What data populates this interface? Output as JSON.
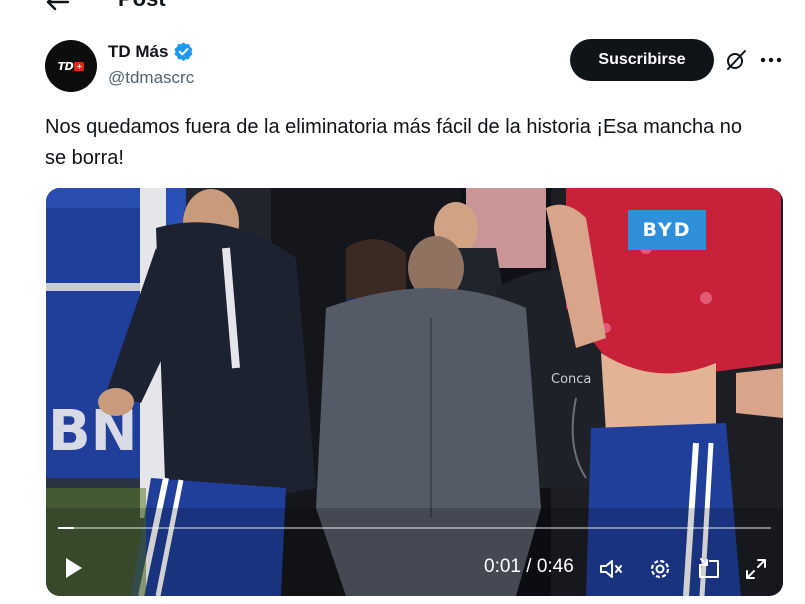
{
  "header": {
    "title": "Post",
    "back_icon": "arrow-left-icon"
  },
  "author": {
    "avatar_text": "TD",
    "avatar_plus": "+",
    "name": "TD Más",
    "handle": "@tdmascrc",
    "verified": true,
    "verified_color": "#1d9bf0"
  },
  "actions": {
    "subscribe_label": "Suscribirse",
    "grok_icon": "grok-icon",
    "more_icon": "more-icon"
  },
  "tweet": {
    "text": "Nos quedamos fuera de la eliminatoria más fácil de la historia ¡Esa mancha no se borra!"
  },
  "video": {
    "sponsor_badge": "BYD",
    "current_time": "0:01",
    "duration": "0:46",
    "time_text": "0:01 / 0:46",
    "progress_fraction": 0.022,
    "controls": [
      "play-icon",
      "mute-icon",
      "settings-icon",
      "pip-icon",
      "fullscreen-icon"
    ]
  },
  "colors": {
    "text_primary": "#0f1419",
    "text_secondary": "#536471",
    "button_bg": "#0f1419",
    "sponsor_blue": "#2f8fd8"
  }
}
